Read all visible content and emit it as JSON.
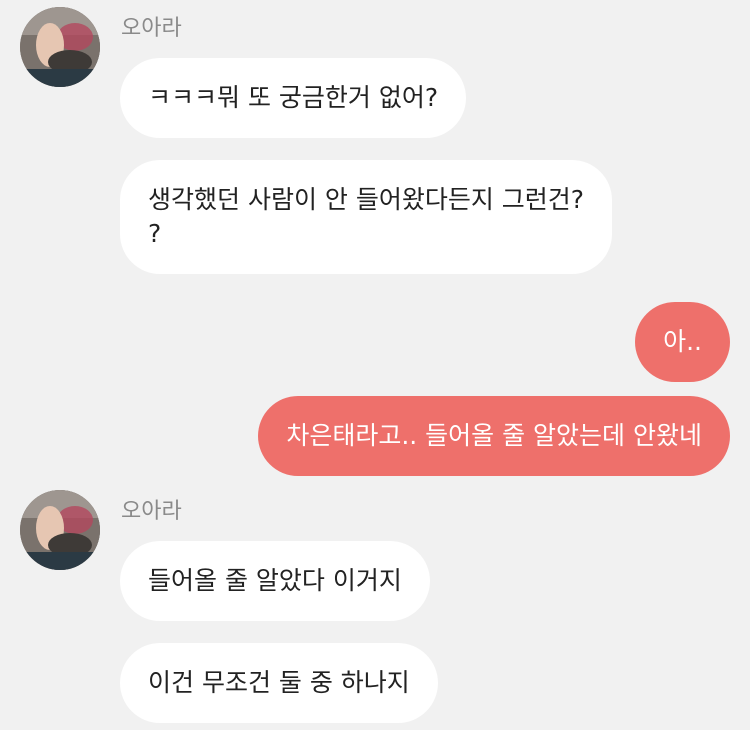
{
  "colors": {
    "background": "#f1f1f1",
    "incoming_bubble": "#ffffff",
    "outgoing_bubble": "#ee706b",
    "sender_name": "#8a8a8a"
  },
  "messages": [
    {
      "type": "sender",
      "name": "오아라"
    },
    {
      "type": "incoming",
      "text": "ㅋㅋㅋ뭐 또 궁금한거 없어?"
    },
    {
      "type": "incoming",
      "text": "생각했던 사람이 안 들어왔다든지 그런건?\n?"
    },
    {
      "type": "outgoing",
      "text": "아.."
    },
    {
      "type": "outgoing",
      "text": "차은태라고.. 들어올 줄 알았는데 안왔네"
    },
    {
      "type": "sender",
      "name": "오아라"
    },
    {
      "type": "incoming",
      "text": "들어올 줄 알았다 이거지"
    },
    {
      "type": "incoming",
      "text": "이건 무조건 둘 중 하나지"
    }
  ]
}
